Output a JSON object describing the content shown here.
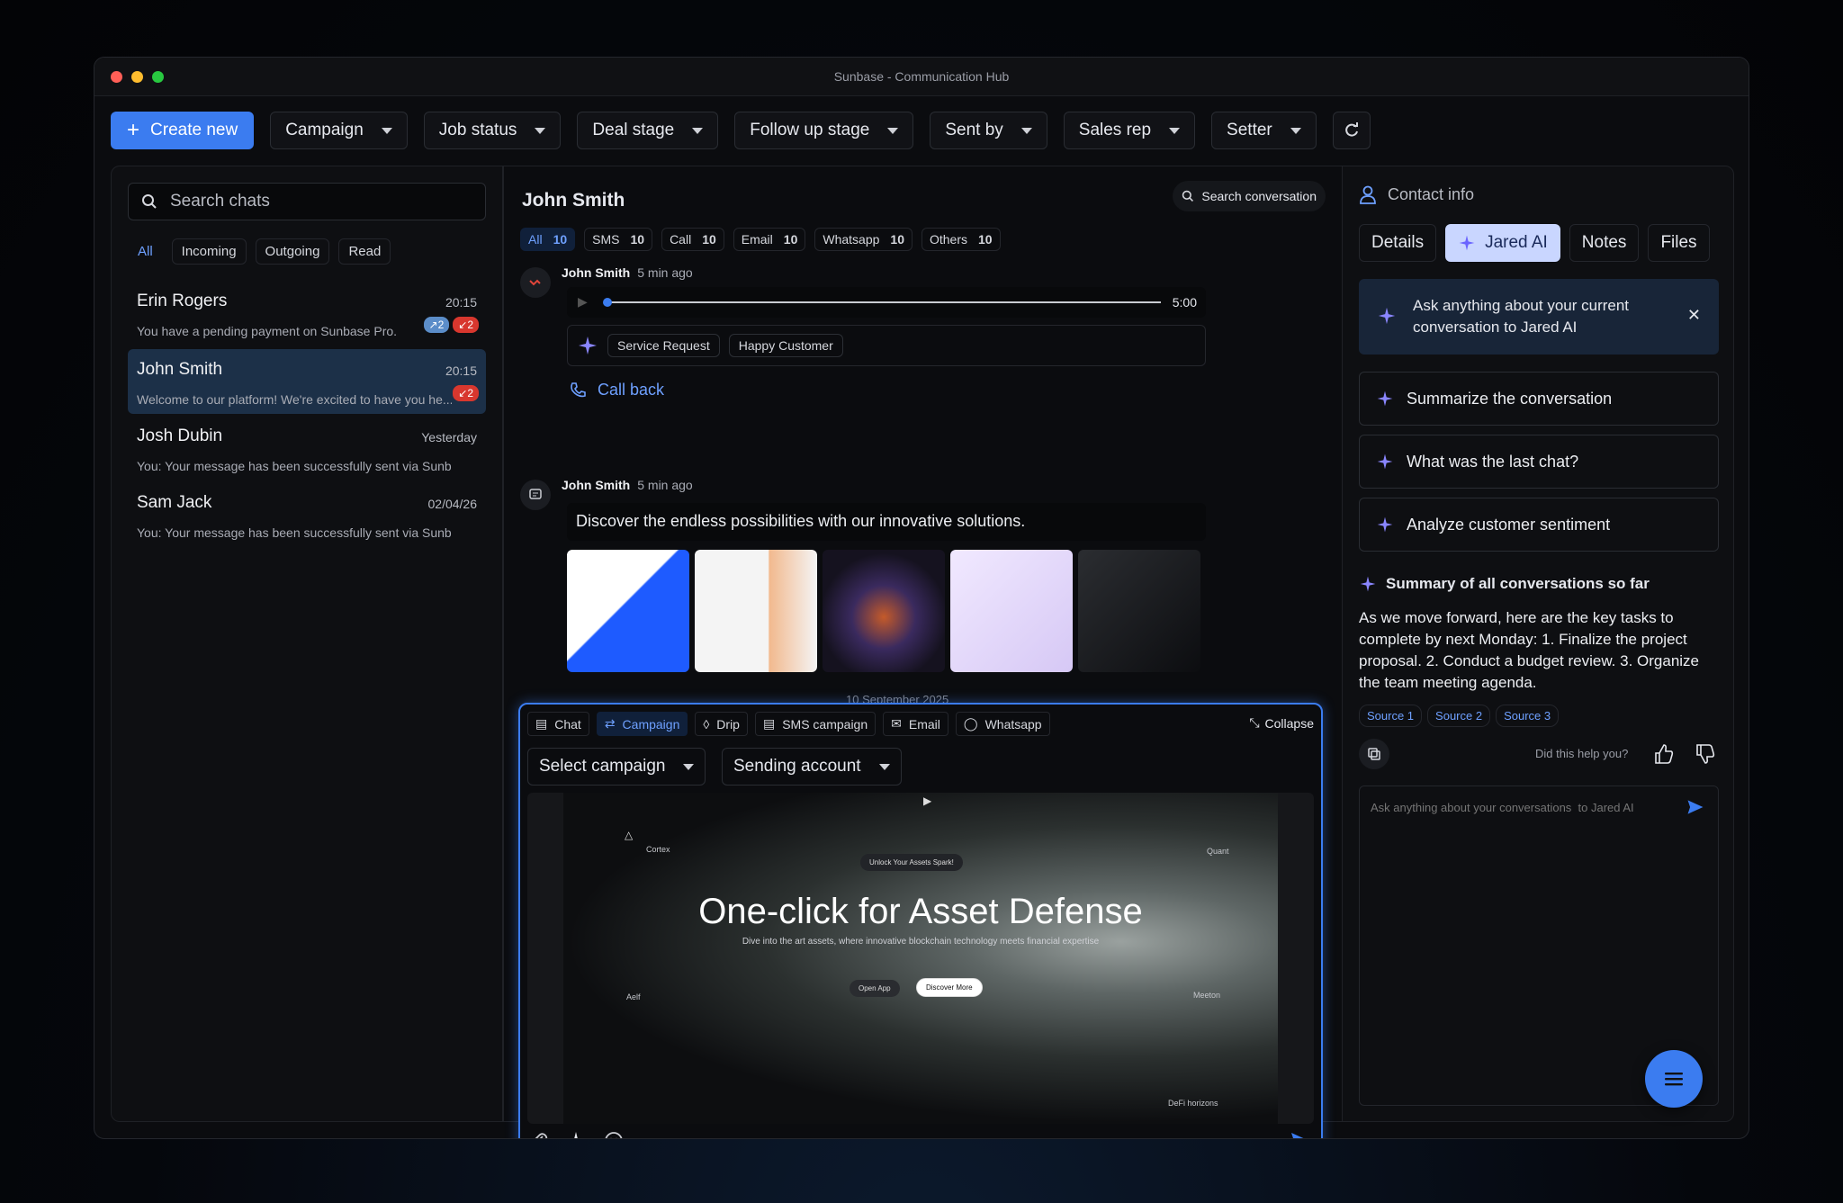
{
  "window": {
    "title": "Sunbase - Communication Hub",
    "dot_colors": [
      "#ff5f57",
      "#febc2e",
      "#28c840"
    ]
  },
  "toolbar": {
    "create_label": "Create new",
    "filters": [
      "Campaign",
      "Job status",
      "Deal stage",
      "Follow up stage",
      "Sent by",
      "Sales rep",
      "Setter"
    ]
  },
  "chats": {
    "search_placeholder": "Search chats",
    "filter_tabs": [
      "All",
      "Incoming",
      "Outgoing",
      "Read"
    ],
    "items": [
      {
        "name": "Erin Rogers",
        "time": "20:15",
        "preview": "You have a pending payment on Sunbase Pro.",
        "badge_a": "2",
        "badge_b": "2"
      },
      {
        "name": "John Smith",
        "time": "20:15",
        "preview": "Welcome to our platform! We're excited to have you he...",
        "badge_b": "2"
      },
      {
        "name": "Josh Dubin",
        "time": "Yesterday",
        "preview": "You: Your message has been successfully sent via Sunbase."
      },
      {
        "name": "Sam Jack",
        "time": "02/04/26",
        "preview": "You: Your message has been successfully sent via Sunbase."
      }
    ]
  },
  "conversation": {
    "contact_name": "John Smith",
    "search_label": "Search conversation",
    "tabs": [
      {
        "label": "All",
        "count": "10"
      },
      {
        "label": "SMS",
        "count": "10"
      },
      {
        "label": "Call",
        "count": "10"
      },
      {
        "label": "Email",
        "count": "10"
      },
      {
        "label": "Whatsapp",
        "count": "10"
      },
      {
        "label": "Others",
        "count": "10"
      }
    ],
    "call_msg": {
      "sender": "John Smith",
      "time": "5 min ago",
      "duration": "5:00",
      "tags": [
        "Service Request",
        "Happy Customer"
      ],
      "callback_label": "Call back"
    },
    "text_msg": {
      "sender": "John Smith",
      "time": "5 min ago",
      "text": "Discover the endless possibilities with our innovative solutions."
    },
    "date_divider": "10 September 2025"
  },
  "composer": {
    "tabs": [
      "Chat",
      "Campaign",
      "Drip",
      "SMS campaign",
      "Email",
      "Whatsapp"
    ],
    "collapse_label": "Collapse",
    "select_campaign": "Select campaign",
    "sending_account": "Sending account",
    "preview": {
      "title": "One-click for Asset Defense",
      "subtitle": "Dive into the art assets, where innovative blockchain technology meets financial expertise",
      "pill": "Unlock Your Assets Spark!",
      "btn_open": "Open App",
      "btn_discover": "Discover More",
      "label_cortex": "Cortex",
      "label_quant": "Quant",
      "label_aelf": "Aelf",
      "label_meeton": "Meeton",
      "label_defi": "DeFi horizons"
    }
  },
  "contact": {
    "header": "Contact info",
    "tabs": [
      "Details",
      "Jared AI",
      "Notes",
      "Files"
    ],
    "ask_card": "Ask anything about your current conversation  to Jared AI",
    "suggestions": [
      "Summarize the conversation",
      "What was the last chat?",
      "Analyze customer sentiment"
    ],
    "summary_title": "Summary of all conversations so far",
    "summary_text": "As we move forward, here are the key tasks to complete by next Monday: 1. Finalize the project proposal. 2. Conduct a budget review. 3. Organize the team meeting agenda.",
    "sources": [
      "Source 1",
      "Source 2",
      "Source 3"
    ],
    "feedback_q": "Did this help you?",
    "ask_placeholder": "Ask anything about your conversations  to Jared AI"
  }
}
